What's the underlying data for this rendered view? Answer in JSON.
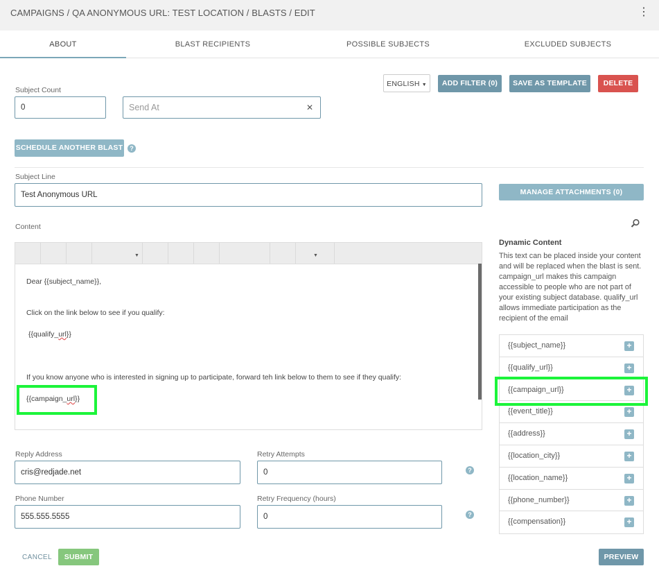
{
  "header": {
    "breadcrumb": "CAMPAIGNS / QA ANONYMOUS URL: TEST LOCATION / BLASTS / EDIT",
    "menu_icon": "⋮"
  },
  "tabs": [
    "ABOUT",
    "BLAST RECIPIENTS",
    "POSSIBLE SUBJECTS",
    "EXCLUDED SUBJECTS"
  ],
  "toolbar": {
    "language": "ENGLISH",
    "add_filter": "ADD FILTER (0)",
    "save_template": "SAVE AS TEMPLATE",
    "delete": "DELETE"
  },
  "form": {
    "subject_count_label": "Subject Count",
    "subject_count_value": "0",
    "send_at_placeholder": "Send At",
    "clear_icon": "✕",
    "schedule_button": "SCHEDULE ANOTHER BLAST",
    "help_icon": "?",
    "subject_line_label": "Subject Line",
    "subject_line_value": "Test Anonymous URL",
    "manage_attachments": "MANAGE ATTACHMENTS (0)",
    "content_label": "Content",
    "reply_label": "Reply Address",
    "reply_value": "cris@redjade.net",
    "retry_attempts_label": "Retry Attempts",
    "retry_attempts_value": "0",
    "phone_label": "Phone Number",
    "phone_value": "555.555.5555",
    "retry_freq_label": "Retry Frequency (hours)",
    "retry_freq_value": "0",
    "cancel": "CANCEL",
    "submit": "SUBMIT",
    "preview": "PREVIEW"
  },
  "editor": {
    "line1": "Dear {{subject_name}},",
    "line2": "Click on the link below to see if you qualify:",
    "line3_prefix": "{{qualify_",
    "line3_word": "url",
    "line3_suffix": "}}",
    "line4": "If you know anyone who is interested in signing up to participate, forward teh link below to them to see if they qualify:",
    "line5_prefix": "{{campaign_",
    "line5_word": "url",
    "line5_suffix": "}}"
  },
  "dynamic_content": {
    "title": "Dynamic Content",
    "description": "This text can be placed inside your content and will be replaced when the blast is sent. campaign_url makes this campaign accessible to people who are not part of your existing subject database. qualify_url allows immediate participation as the recipient of the email",
    "plus": "+",
    "items": [
      "{{subject_name}}",
      "{{qualify_url}}",
      "{{campaign_url}}",
      "{{event_title}}",
      "{{address}}",
      "{{location_city}}",
      "{{location_name}}",
      "{{phone_number}}",
      "{{compensation}}"
    ]
  },
  "colors": {
    "primary": "#6f97a9",
    "light_primary": "#8fb7c6",
    "danger": "#d9534f",
    "success": "#86c77d",
    "highlight": "#1cf43a"
  }
}
